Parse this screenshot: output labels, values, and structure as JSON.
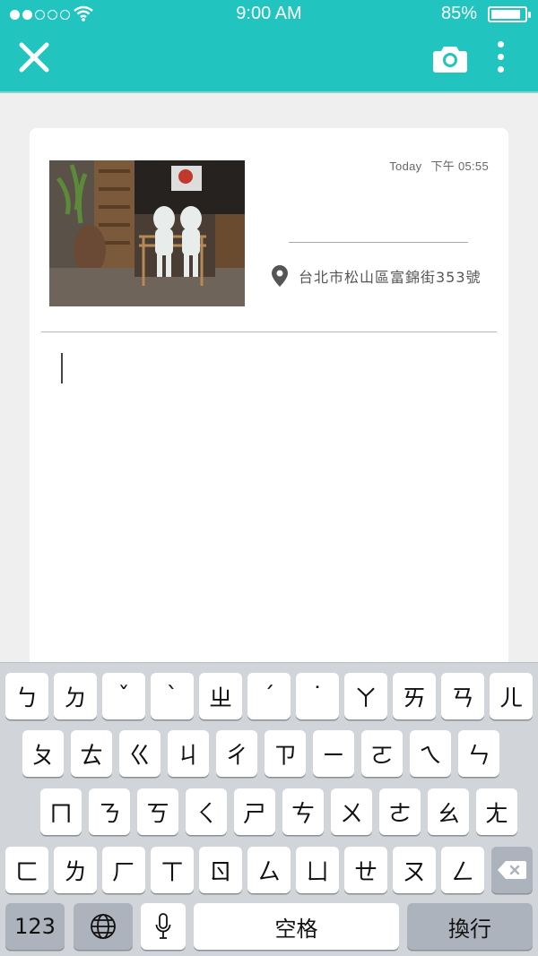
{
  "status_bar": {
    "time": "9:00  AM",
    "battery": "85%",
    "signal_dots": 5,
    "signal_filled": 2
  },
  "toolbar": {
    "close_icon": "close-icon",
    "camera_icon": "camera-icon",
    "menu_icon": "more-vertical-icon"
  },
  "entry": {
    "date_label": "Today",
    "time_label": "下午 05:55",
    "location": "台北市松山區富錦街353號",
    "photo_description": "photo"
  },
  "keyboard": {
    "row1": [
      "ㄅ",
      "ㄉ",
      "ˇ",
      "ˋ",
      "ㄓ",
      "ˊ",
      "˙",
      "ㄚ",
      "ㄞ",
      "ㄢ",
      "ㄦ"
    ],
    "row2": [
      "ㄆ",
      "ㄊ",
      "ㄍ",
      "ㄐ",
      "ㄔ",
      "ㄗ",
      "ㄧ",
      "ㄛ",
      "ㄟ",
      "ㄣ"
    ],
    "row3": [
      "ㄇ",
      "ㄋ",
      "ㄎ",
      "ㄑ",
      "ㄕ",
      "ㄘ",
      "ㄨ",
      "ㄜ",
      "ㄠ",
      "ㄤ"
    ],
    "row4": [
      "ㄈ",
      "ㄌ",
      "ㄏ",
      "ㄒ",
      "ㄖ",
      "ㄙ",
      "ㄩ",
      "ㄝ",
      "ㄡ",
      "ㄥ"
    ],
    "numbers_label": "123",
    "space_label": "空格",
    "return_label": "換行"
  },
  "colors": {
    "accent": "#21c4be",
    "keyboard_bg": "#d1d4d9"
  }
}
